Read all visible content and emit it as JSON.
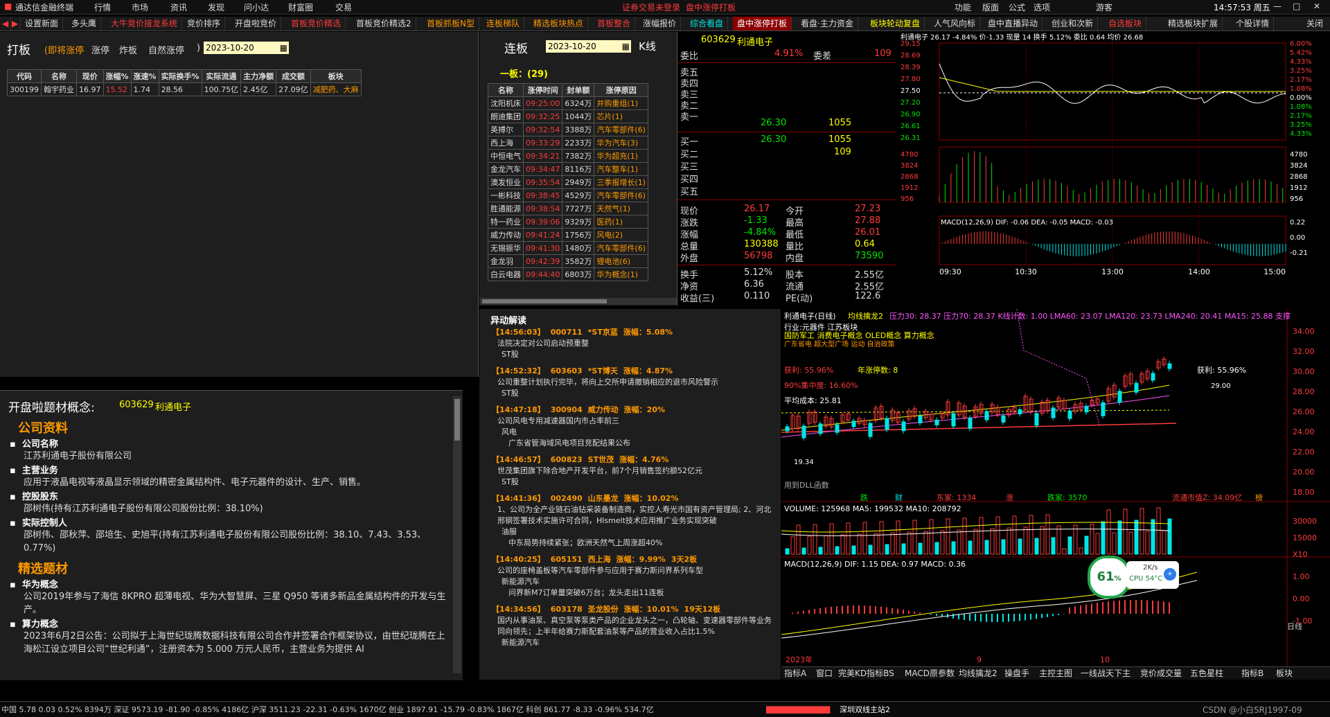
{
  "app": {
    "title": "通达信金融终端",
    "menu": [
      "行情",
      "市场",
      "资讯",
      "发现",
      "问小达",
      "财富圈",
      "交易"
    ],
    "notice": "证券交易未登录",
    "ticker_window": "盘中涨停打板",
    "right_menu": [
      "功能",
      "版面",
      "公式",
      "选项"
    ],
    "user": "游客",
    "clock": "14:57:53 周五"
  },
  "tabs": [
    "设置新面",
    "多头鹰",
    "大牛竞价接龙系统",
    "竞价排序",
    "开盘啦竞价",
    "首板竞价精选",
    "首板竞价精选2",
    "首板抓板N型",
    "连板梯队",
    "精选板块热点",
    "首板整合",
    "涨幅报价",
    "综合看盘",
    "盘中涨停打板",
    "看盘·主力资金",
    "板块轮动复盘",
    "人气风向标",
    "盘中直播异动",
    "创业和次新",
    "自选板块",
    "精选板块扩展",
    "个股详情"
  ],
  "tab_close": "关闭",
  "daban": {
    "title": "打板",
    "subtitle": "(即将涨停",
    "options": [
      "涨停",
      "炸板",
      "自然涨停"
    ],
    "paren": ")",
    "date": "2023-10-20",
    "headers": [
      "代码",
      "名称",
      "现价",
      "涨幅%",
      "涨速%",
      "实际换手%",
      "实际流通",
      "主力净额",
      "成交额",
      "板块"
    ],
    "rows": [
      [
        "300199",
        "翰宇药业",
        "16.97",
        "15.52",
        "1.74",
        "28.56",
        "100.75亿",
        "2.45亿",
        "27.09亿",
        "减肥药、大麻"
      ]
    ]
  },
  "concept": {
    "title": "开盘啦题材概念:",
    "code": "603629",
    "name": "利通电子",
    "section1": "公司资料",
    "items1": [
      {
        "label": "公司名称",
        "text": "江苏利通电子股份有限公司"
      },
      {
        "label": "主营业务",
        "text": "应用于液晶电视等液晶显示领域的精密金属结构件、电子元器件的设计、生产、销售。"
      },
      {
        "label": "控股股东",
        "text": "邵树伟(持有江苏利通电子股份有限公司股份比例：38.10%)"
      },
      {
        "label": "实际控制人",
        "text": "邵树伟、邵秋萍、邵培生、史旭平(持有江苏利通电子股份有限公司股份比例：38.10、7.43、3.53、0.77%)"
      }
    ],
    "section2": "精选题材",
    "items2": [
      {
        "label": "华为概念",
        "text": "公司2019年参与了海信 8KPRO 超薄电视、华为大智慧屏、三星 Q950 等诸多新品金属结构件的开发与生产。"
      },
      {
        "label": "算力概念",
        "text": "2023年6月2日公告：公司拟于上海世纪珑腾数据科技有限公司合作并签署合作框架协议，由世纪珑腾在上海松江设立项目公司“世纪利通”，注册资本为 5.000 万元人民币，主营业务为提供 AI"
      }
    ]
  },
  "lianban": {
    "title": "连板",
    "date": "2023-10-20",
    "kline": "K线",
    "group": "一板：(29)",
    "headers": [
      "名称",
      "涨停时间",
      "封单额",
      "涨停原因"
    ],
    "rows": [
      [
        "沈阳机床",
        "09:25:00",
        "6324万",
        "并购重组(1)"
      ],
      [
        "朗迪集团",
        "09:32:25",
        "1044万",
        "芯片(1)"
      ],
      [
        "英搏尔",
        "09:32:54",
        "3388万",
        "汽车零部件(6)"
      ],
      [
        "西上海",
        "09:33:29",
        "2233万",
        "华为汽车(3)"
      ],
      [
        "中恒电气",
        "09:34:21",
        "7382万",
        "华为超充(1)"
      ],
      [
        "金龙汽车",
        "09:34:47",
        "8116万",
        "汽车整车(1)"
      ],
      [
        "澳发恒业",
        "09:35:54",
        "2949万",
        "三季报增长(1)"
      ],
      [
        "一彬科技",
        "09:38:45",
        "4529万",
        "汽车零部件(6)"
      ],
      [
        "胜通能源",
        "09:38:54",
        "7727万",
        "天然气(1)"
      ],
      [
        "特一药业",
        "09:39:06",
        "9329万",
        "医药(1)"
      ],
      [
        "威力传动",
        "09:41:24",
        "1756万",
        "风电(2)"
      ],
      [
        "无锡振华",
        "09:41:30",
        "1480万",
        "汽车零部件(6)"
      ],
      [
        "金龙羽",
        "09:42:39",
        "3582万",
        "锂电池(6)"
      ],
      [
        "白云电器",
        "09:44:40",
        "6803万",
        "华为概念(1)"
      ]
    ]
  },
  "yidong": {
    "title": "异动解读",
    "items": [
      {
        "time": "【14:56:03】",
        "code": "000711",
        "name": "*ST京蓝",
        "rise": "涨幅：5.08%",
        "desc": "法院决定对公司启动预重整",
        "tags": [
          "ST股"
        ]
      },
      {
        "time": "【14:52:32】",
        "code": "603603",
        "name": "*ST博天",
        "rise": "涨幅：4.87%",
        "desc": "公司重整计划执行完毕，将向上交所申请撤销相应的退市风险警示",
        "tags": [
          "ST股"
        ]
      },
      {
        "time": "【14:47:18】",
        "code": "300904",
        "name": "威力传动",
        "rise": "涨幅：20%",
        "desc": "公司风电专用减速器国内市占率前三",
        "tags": [
          "风电",
          "广东省管海域风电项目竞配结果公布"
        ]
      },
      {
        "time": "【14:46:57】",
        "code": "600823",
        "name": "ST世茂",
        "rise": "涨幅：4.76%",
        "desc": "世茂集团旗下除合地产开发平台，前7个月销售签约额52亿元",
        "tags": [
          "ST股"
        ]
      },
      {
        "time": "【14:41:36】",
        "code": "002490",
        "name": "山东墨龙",
        "rise": "涨幅：10.02%",
        "desc": "1、公司为全产业链石油钻采装备制造商，实控人寿光市国有资产管理局; 2、河北邢钢签署技术实施许可合同，Hlsmelt技术应用推广业务实现突破",
        "tags": [
          "油服",
          "中东局势持续紧张；欧洲天然气上周涨超40%"
        ]
      },
      {
        "time": "【14:40:25】",
        "code": "605151",
        "name": "西上海",
        "rise": "涨幅：9.99%",
        "extra": "3天2板",
        "desc": "公司的座椅盖板等汽车零部件参与应用于赛力斯问界系列车型",
        "tags": [
          "新能源汽车",
          "问界新M7订单量突破6万台；龙头走出11连板"
        ]
      },
      {
        "time": "【14:34:56】",
        "code": "603178",
        "name": "圣龙股份",
        "rise": "涨幅：10.01%",
        "extra": "19天12板",
        "desc": "国内从事油泵、真空泵等泵类产品的企业龙头之一，凸轮轴、变速器零部件等业务同向领先；上半年给赛力斯配套油泵等产品的营业收入占比1.5%",
        "tags": [
          "新能源汽车"
        ]
      }
    ]
  },
  "quote": {
    "code": "603629",
    "name": "利通电子",
    "weibi_label": "委比",
    "weibi": "4.91%",
    "weicha_label": "委差",
    "weicha": "109",
    "sells": [
      "卖五",
      "卖四",
      "卖三",
      "卖二",
      "卖一"
    ],
    "sell1_price": "26.30",
    "sell1_vol": "1055",
    "buys": [
      "买一",
      "买二",
      "买三",
      "买四",
      "买五"
    ],
    "buy1_price": "26.30",
    "buy1_vol": "1055",
    "buy2_vol": "109",
    "stats": [
      [
        "现价",
        "26.17",
        "今开",
        "27.23"
      ],
      [
        "涨跌",
        "-1.33",
        "最高",
        "27.88"
      ],
      [
        "涨幅",
        "-4.84%",
        "最低",
        "26.01"
      ],
      [
        "总量",
        "130388",
        "量比",
        "0.64"
      ],
      [
        "外盘",
        "56798",
        "内盘",
        "73590"
      ]
    ],
    "stats2": [
      [
        "换手",
        "5.12%",
        "股本",
        "2.55亿"
      ],
      [
        "净资",
        "6.36",
        "流通",
        "2.55亿"
      ],
      [
        "收益(三)",
        "0.110",
        "PE(动)",
        "122.6"
      ]
    ]
  },
  "mini": {
    "header": "利通电子 26.17 -4.84% 价-1.33 现量 14 换手 5.12% 委比 0.64 均价 26.68",
    "price_ticks": [
      "29.15",
      "28.69",
      "28.39",
      "27.80",
      "27.50",
      "27.20",
      "26.90",
      "26.61",
      "26.31",
      "4780",
      "3824",
      "2868",
      "1912",
      "956"
    ],
    "pct_ticks": [
      "6.00%",
      "5.42%",
      "4.33%",
      "3.25%",
      "2.17%",
      "1.08%",
      "0.00%",
      "1.08%",
      "2.17%",
      "3.25%",
      "4.33%",
      "4780",
      "3824",
      "2868",
      "1912",
      "956"
    ],
    "macd_label": "MACD(12,26,9) DIF: -0.06 DEA: -0.05 MACD: -0.03",
    "macd_ticks": [
      "0.22",
      "0.00",
      "-0.21"
    ],
    "time_ticks": [
      "09:30",
      "10:30",
      "13:00",
      "14:00",
      "15:00"
    ]
  },
  "kline": {
    "title": "利通电子(日线)",
    "indicator": "均线擒龙2",
    "ma_values": "压力30: 28.37  压力70: 28.37  K线计数: 1.00  LMA60: 23.07  LMA120: 23.73  LMA240: 20.41  MA15: 25.88  支撑",
    "industry": "行业:元器件 江苏板块",
    "concepts": "国防军工 消费电子概念 OLED概念 算力概念",
    "concepts2": "广东省电 超大型广场 运动 自治政策",
    "profit1": "获利: 55.96%",
    "limit_count": "年涨停数: 8",
    "concentration": "90%集中度: 16.60%",
    "avg_cost": "平均成本: 25.81",
    "profit2": "获利: 55.96%",
    "high_label": "29.00",
    "low_label": "19.34",
    "y_ticks": [
      "34.00",
      "32.00",
      "30.00",
      "28.00",
      "26.00",
      "24.00",
      "22.00",
      "20.00",
      "18.00"
    ],
    "dll": "用到DLL函数",
    "bottom_labels": [
      "跌",
      "财",
      "东家: 1334",
      "涨",
      "跌家: 3570",
      "流通市值Z: 34.09亿",
      "榜"
    ],
    "volume_label": "VOLUME: 125968  MA5: 199532  MA10: 208792",
    "vol_ticks": [
      "30000",
      "15000",
      "X10"
    ],
    "macd_label": "MACD(12,26,9) DIF: 1.15 DEA: 0.97 MACD: 0.36",
    "macd_ticks": [
      "1.00",
      "0.00",
      "-1.00"
    ],
    "x_ticks": [
      "2023年",
      "9",
      "10"
    ],
    "period": "日线"
  },
  "bottomtabs": [
    "指标A",
    "窗口",
    "完美KD指标BS",
    "MACD原参数",
    "均线擒龙2",
    "操盘手",
    "主控主图",
    "一线战天下主",
    "竞价成交量",
    "五色星柱",
    "指标B",
    "板块"
  ],
  "cpu": {
    "pct": "61",
    "speed": "2K/s",
    "temp": "CPU 54°C"
  },
  "status": {
    "text": "中国 5.78  0.03  0.52%  8394万  深证 9573.19  -81.90  -0.85%  4186亿  沪深 3511.23  -22.31  -0.63%  1670亿  创业 1897.91  -15.79  -0.83%  1867亿  科创 861.77  -8.33  -0.96%  534.7亿",
    "link": "深圳双线主站2",
    "watermark": "CSDN @小白SRJ1997-09"
  },
  "colors": {
    "up": "#ff3b3b",
    "down": "#00e600",
    "accent": "#ffff00",
    "bg": "#000000"
  }
}
